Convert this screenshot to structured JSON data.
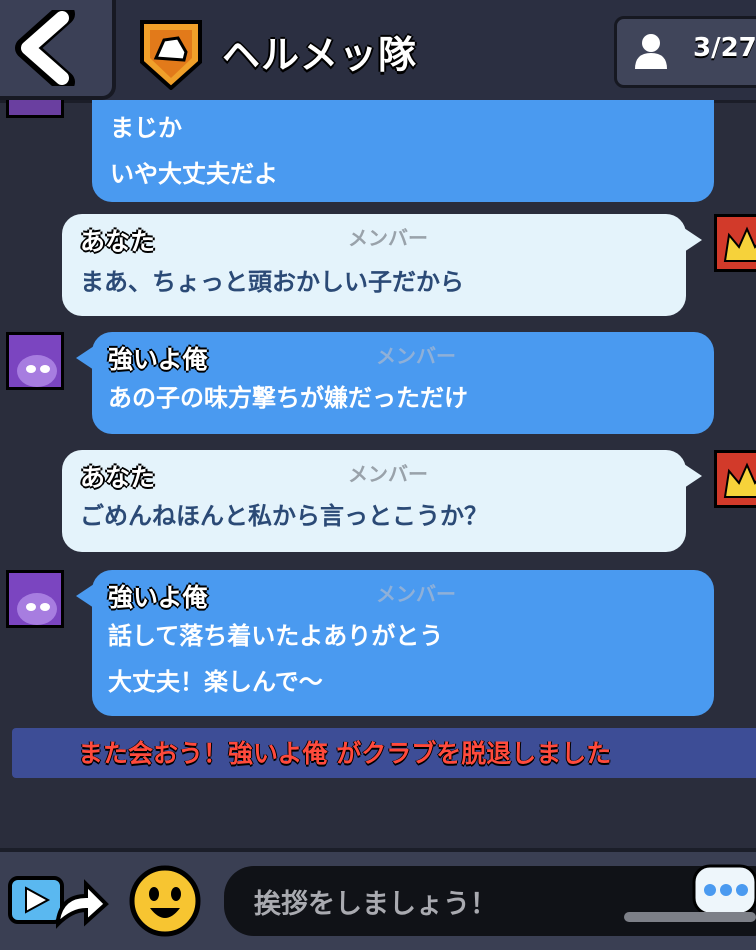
{
  "header": {
    "club_name": "ヘルメッ隊",
    "member_count": "3/27",
    "icons": [
      "back-arrow-icon",
      "club-badge-icon",
      "person-icon"
    ]
  },
  "messages": [
    {
      "sender": "",
      "role": "",
      "lines": [
        "まじか",
        "いや大丈夫だよ"
      ],
      "style": "blue"
    },
    {
      "sender": "あなた",
      "role": "メンバー",
      "lines": [
        "まあ、ちょっと頭おかしい子だから"
      ],
      "style": "white"
    },
    {
      "sender": "強いよ俺",
      "role": "メンバー",
      "lines": [
        "あの子の味方撃ちが嫌だっただけ"
      ],
      "style": "blue"
    },
    {
      "sender": "あなた",
      "role": "メンバー",
      "lines": [
        "ごめんねほんと私から言っとこうか？"
      ],
      "style": "white"
    },
    {
      "sender": "強いよ俺",
      "role": "メンバー",
      "lines": [
        "話して落ち着いたよありがとう",
        "大丈夫！楽しんで〜"
      ],
      "style": "blue"
    }
  ],
  "system_message": "また会おう！強いよ俺 がクラブを脱退しました",
  "input": {
    "placeholder": "挨拶をしましょう！"
  },
  "colors": {
    "blue_bubble": "#4a9af0",
    "white_bubble": "#e4f3fb",
    "system_bar": "#3d4d96",
    "system_text": "#ff4a3c"
  }
}
